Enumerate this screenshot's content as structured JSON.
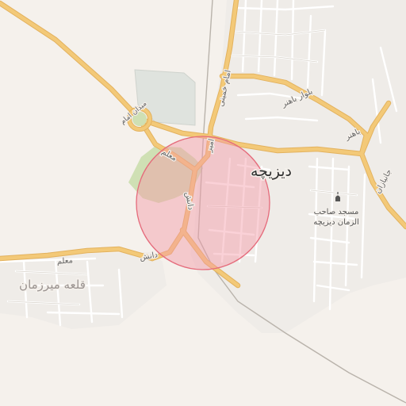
{
  "map": {
    "colors": {
      "background": "#f5f1ec",
      "major_road": "#f3c978",
      "major_road_casing": "#e3b25e",
      "minor_road": "#ffffff",
      "minor_road_casing": "#d9d4cc",
      "park": "#cfe0b4",
      "building_block": "#dcdcd8",
      "radius_fill": "#f59aa6",
      "radius_stroke": "#e56b7b",
      "town_label": "#333333",
      "road_label": "#666666"
    },
    "labels": {
      "town": "دیزیچه",
      "village": "قلعه میرزمان",
      "mosque_line1": "مسجد صاحب",
      "mosque_line2": "الزمان دیزیچه",
      "road_imam_khomeini": "امام خمینی",
      "road_bahonar_blvd": "بلوار باهنر",
      "road_bahonar": "باهنر",
      "road_janbazan": "جانبازان",
      "road_moalem": "معلم",
      "road_moalem_west": "معلم",
      "road_danesh": "دانش",
      "road_danesh_south": "دانش",
      "road_amir": "امیر",
      "roundabout": "میدان امام"
    },
    "icons": {
      "poi": "mosque-icon"
    }
  }
}
